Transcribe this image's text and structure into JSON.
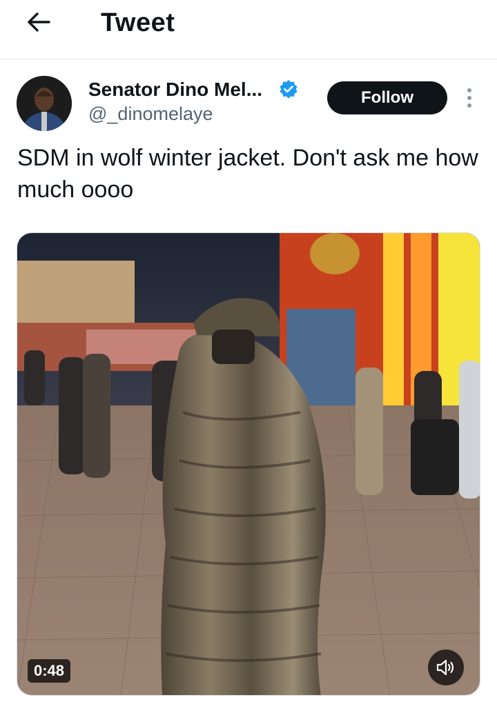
{
  "header": {
    "title": "Tweet",
    "back_icon": "arrow-left-icon"
  },
  "author": {
    "name": "Senator Dino Mel...",
    "handle": "@_dinomelaye",
    "verified": true,
    "verified_color": "#1d9bf0"
  },
  "actions": {
    "follow_label": "Follow",
    "more_icon": "more-vertical-icon"
  },
  "tweet": {
    "text": "SDM in wolf winter jacket. Don't ask me how much oooo"
  },
  "media": {
    "type": "video",
    "duration": "0:48",
    "sound_icon": "speaker-icon"
  }
}
